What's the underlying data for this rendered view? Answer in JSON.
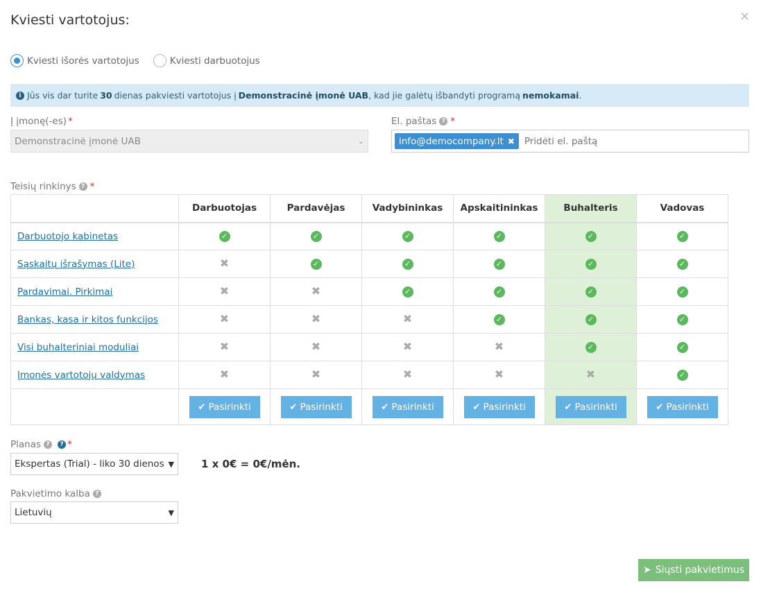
{
  "dialog": {
    "title": "Kviesti vartotojus:",
    "close_glyph": "×"
  },
  "invite_type": {
    "options": [
      {
        "label": "Kviesti išorės vartotojus",
        "checked": true
      },
      {
        "label": "Kviesti darbuotojus",
        "checked": false
      }
    ]
  },
  "info": {
    "part1": "Jūs vis dar turite",
    "days": "30",
    "part2": "dienas pakviesti vartotojus į",
    "company": "Demonstracinė įmonė UAB",
    "part3": ", kad jie galėtų išbandyti programą",
    "free": "nemokamai",
    "part4": "."
  },
  "company_field": {
    "label": "Į įmonę(-es)",
    "required": "*",
    "value": "Demonstracinė įmonė UAB"
  },
  "email_field": {
    "label": "El. paštas",
    "required": "*",
    "tags": [
      "info@democompany.lt"
    ],
    "placeholder": "Pridėti el. paštą"
  },
  "permissions": {
    "label": "Teisių rinkinys",
    "required": "*",
    "roles": [
      "Darbuotojas",
      "Pardavėjas",
      "Vadybininkas",
      "Apskaitininkas",
      "Buhalteris",
      "Vadovas"
    ],
    "highlighted_role_index": 4,
    "rows": [
      {
        "name": "Darbuotojo kabinetas",
        "access": [
          true,
          true,
          true,
          true,
          true,
          true
        ]
      },
      {
        "name": "Sąskaitų išrašymas (Lite)",
        "access": [
          false,
          true,
          true,
          true,
          true,
          true
        ]
      },
      {
        "name": "Pardavimai. Pirkimai",
        "access": [
          false,
          false,
          true,
          true,
          true,
          true
        ]
      },
      {
        "name": "Bankas, kasa ir kitos funkcijos",
        "access": [
          false,
          false,
          false,
          true,
          true,
          true
        ]
      },
      {
        "name": "Visi buhalteriniai moduliai",
        "access": [
          false,
          false,
          false,
          false,
          true,
          true
        ]
      },
      {
        "name": "Įmonės vartotojų valdymas",
        "access": [
          false,
          false,
          false,
          false,
          false,
          true
        ]
      }
    ],
    "select_label": "Pasirinkti"
  },
  "plan": {
    "label": "Planas",
    "required": "*",
    "value": "Ekspertas (Trial) - liko 30 dienos",
    "price": "1 x 0€ = 0€/mėn."
  },
  "language": {
    "label": "Pakvietimo kalba",
    "value": "Lietuvių"
  },
  "send_button": "Siųsti pakvietimus",
  "colors": {
    "accent": "#3d8fd1",
    "highlight": "#dff0d8",
    "ok": "#5cb85c",
    "send": "#7cbf7c"
  }
}
